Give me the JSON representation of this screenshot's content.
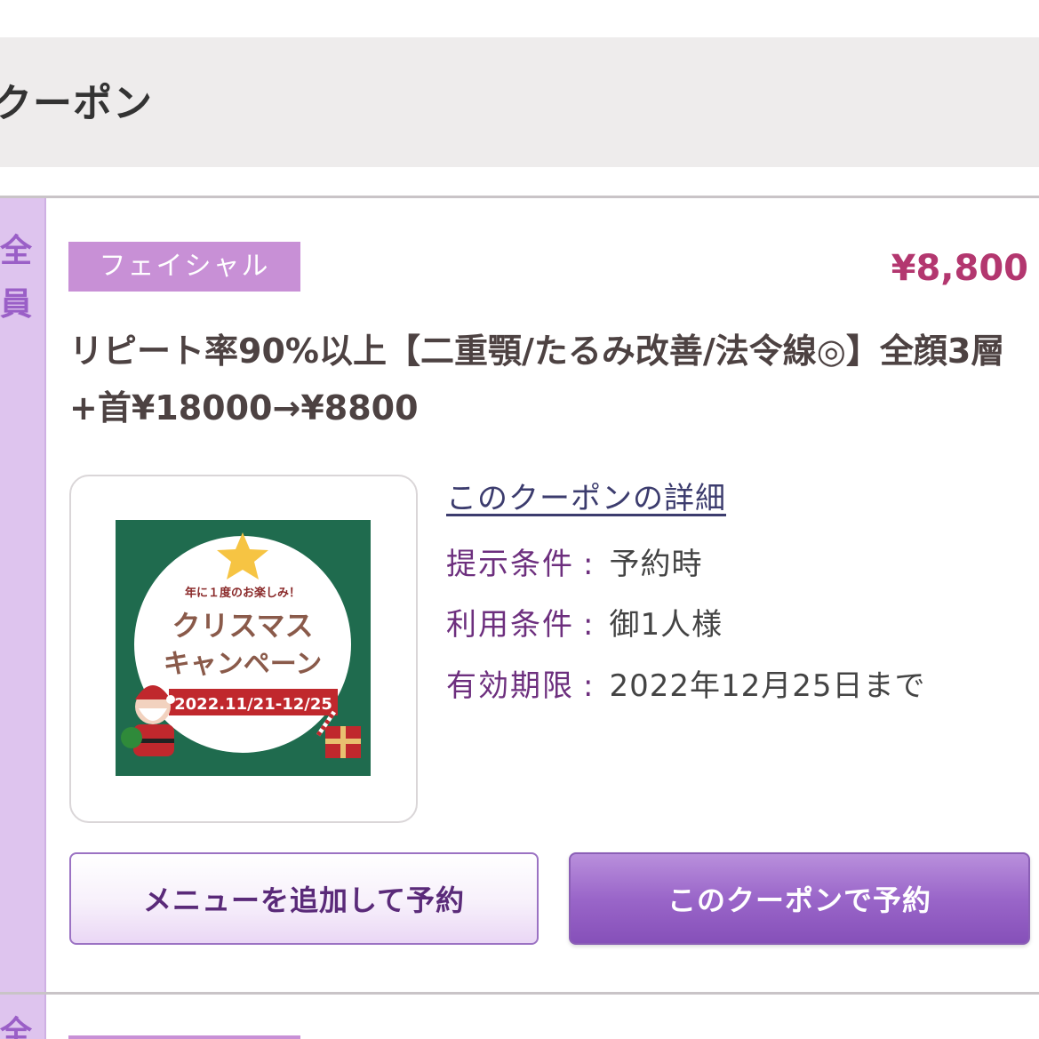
{
  "section": {
    "title": "クーポン"
  },
  "coupon": {
    "target": "全員",
    "category": "フェイシャル",
    "price": "¥8,800",
    "title": "リピート率90%以上【二重顎/たるみ改善/法令線◎】全顔3層+首¥18000→¥8800",
    "detail_link": "このクーポンの詳細",
    "conditions": [
      {
        "label": "提示条件",
        "value": "予約時"
      },
      {
        "label": "利用条件",
        "value": "御1人様"
      },
      {
        "label": "有効期限",
        "value": "2022年12月25日まで"
      }
    ],
    "image": {
      "tagline": "年に１度のお楽しみ！",
      "line1": "クリスマス",
      "line2": "キャンペーン",
      "dates": "2022.11/21-12/25"
    },
    "buttons": {
      "add_menu": "メニューを追加して予約",
      "reserve": "このクーポンで予約"
    }
  },
  "next_card": {
    "target_partial": "全"
  },
  "colors": {
    "accent_purple": "#9a66c9",
    "price_color": "#b3376f",
    "badge_bg": "#c890d6",
    "sidebar_bg": "#dec4ee",
    "image_green": "#1f6b4e",
    "image_red": "#c0282d",
    "star_yellow": "#f6c443"
  }
}
